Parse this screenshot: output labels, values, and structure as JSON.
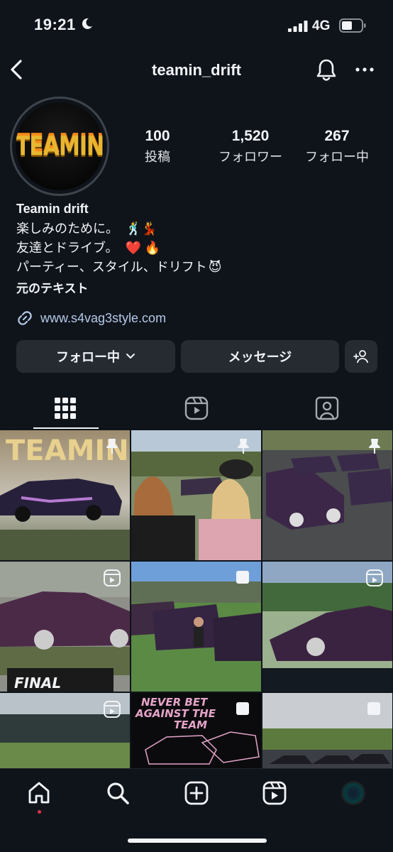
{
  "status_bar": {
    "time": "19:21",
    "network": "4G"
  },
  "header": {
    "username": "teamin_drift"
  },
  "profile": {
    "avatar_logo_text": "TEAMIN",
    "stats": [
      {
        "value": "100",
        "label": "投稿"
      },
      {
        "value": "1,520",
        "label": "フォロワー"
      },
      {
        "value": "267",
        "label": "フォロー中"
      }
    ],
    "name": "Teamin drift",
    "bio_lines": [
      {
        "text": "楽しみのために。",
        "emoji": "🕺💃"
      },
      {
        "text": "友達とドライブ。",
        "emoji": "❤️ 🔥"
      },
      {
        "text": "パーティー、スタイル、ドリフト",
        "emoji": "😈"
      }
    ],
    "translate_label": "元のテキスト",
    "link": "www.s4vag3style.com"
  },
  "buttons": {
    "following": "フォロー中",
    "message": "メッセージ"
  },
  "tabs": [
    "grid-icon",
    "reels-icon",
    "tagged-icon"
  ],
  "grid": {
    "overlay_texts": [
      "TEAMIN",
      "TEAMIN",
      "FINAL",
      "NEVER BET",
      "AGAINST THE",
      "TEAM"
    ]
  },
  "colors": {
    "background": "#0f141b",
    "button": "#262b32",
    "link": "#b5c9e6",
    "notification_dot": "#e73347"
  }
}
